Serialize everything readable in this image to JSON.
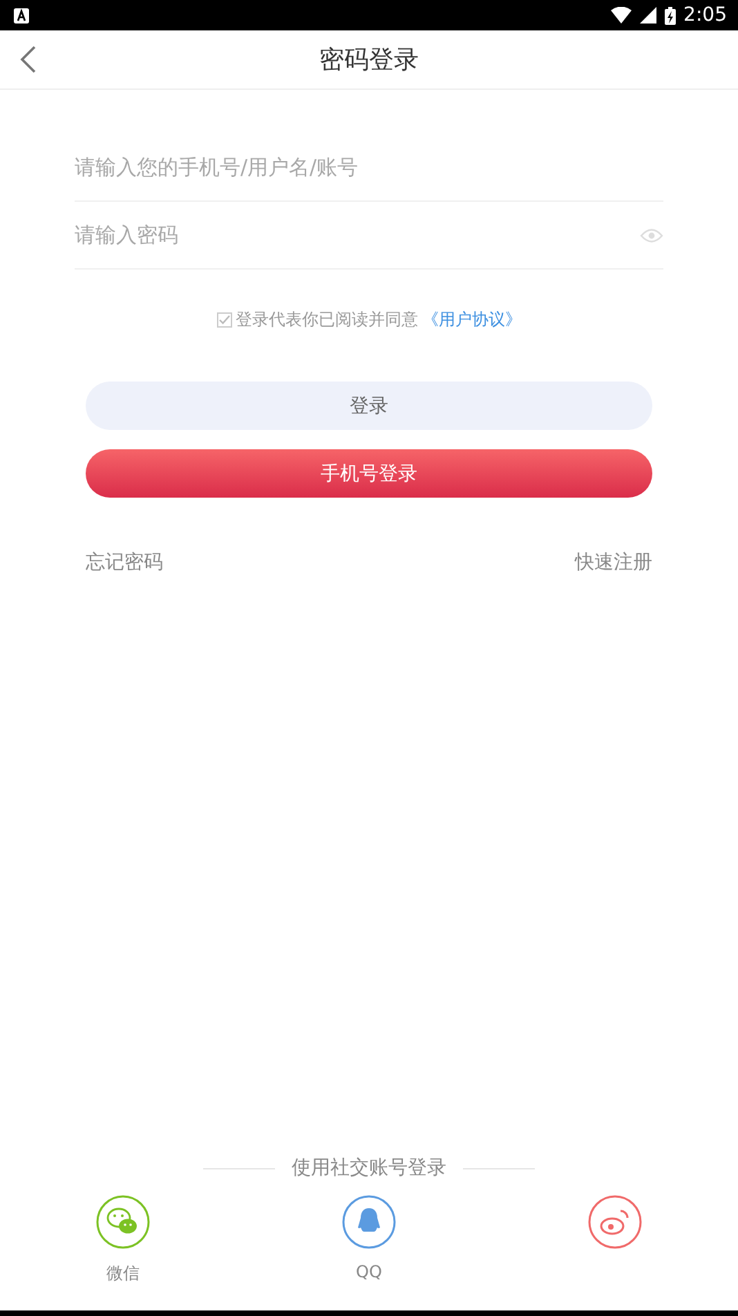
{
  "status_bar": {
    "time": "2:05"
  },
  "header": {
    "title": "密码登录"
  },
  "fields": [
    {
      "placeholder": "请输入您的手机号/用户名/账号",
      "kind": "text"
    },
    {
      "placeholder": "请输入密码",
      "kind": "password"
    }
  ],
  "agreement": {
    "checked": true,
    "text": "登录代表你已阅读并同意",
    "link": "《用户协议》"
  },
  "buttons": [
    {
      "label": "登录",
      "kind": "secondary"
    },
    {
      "label": "手机号登录",
      "kind": "primary"
    }
  ],
  "links": {
    "left": "忘记密码",
    "right": "快速注册"
  },
  "social": {
    "title": "使用社交账号登录",
    "items": [
      {
        "kind": "wechat",
        "label": "微信"
      },
      {
        "kind": "qq",
        "label": "QQ"
      },
      {
        "kind": "weibo"
      }
    ]
  }
}
